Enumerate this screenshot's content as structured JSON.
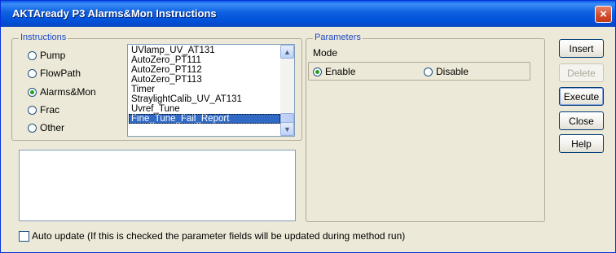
{
  "window": {
    "title": "AKTAready P3 Alarms&Mon Instructions",
    "close_glyph": "×"
  },
  "instructions": {
    "group_label": "Instructions",
    "radios": [
      {
        "label": "Pump",
        "checked": false
      },
      {
        "label": "FlowPath",
        "checked": false
      },
      {
        "label": "Alarms&Mon",
        "checked": true
      },
      {
        "label": "Frac",
        "checked": false
      },
      {
        "label": "Other",
        "checked": false
      }
    ],
    "list_items": [
      "UVlamp_UV_AT131",
      "AutoZero_PT111",
      "AutoZero_PT112",
      "AutoZero_PT113",
      "Timer",
      "StraylightCalib_UV_AT131",
      "Uvref_Tune",
      "Fine_Tune_Fail_Report"
    ],
    "selected_item": "Fine_Tune_Fail_Report",
    "scroll_up_glyph": "▲",
    "scroll_down_glyph": "▼"
  },
  "parameters": {
    "group_label": "Parameters",
    "mode_label": "Mode",
    "enable_label": "Enable",
    "disable_label": "Disable",
    "selected_mode": "Enable"
  },
  "buttons": {
    "insert": "Insert",
    "delete": "Delete",
    "execute": "Execute",
    "close": "Close",
    "help": "Help"
  },
  "auto_update": {
    "label": "Auto update (If this is checked the parameter fields will be updated during method run)",
    "checked": false
  },
  "colors": {
    "title_bar": "#0050d8",
    "group_label": "#1e48c9",
    "selection": "#316ac5",
    "radio_dot": "#21a121"
  },
  "icons": [
    "close-icon",
    "scroll-up-icon",
    "scroll-down-icon"
  ]
}
